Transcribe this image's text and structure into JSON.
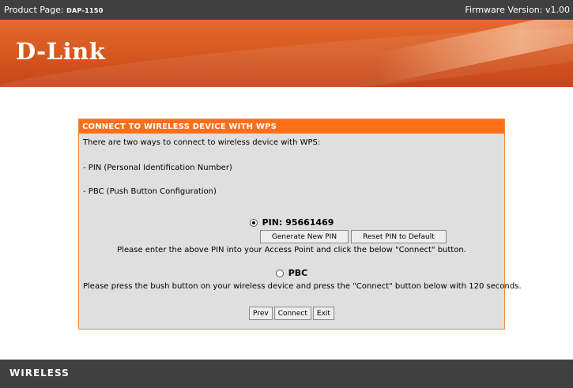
{
  "header": {
    "product_label": "Product Page: ",
    "product_model": "DAP-1150",
    "firmware": "Firmware Version: v1.00"
  },
  "banner": {
    "logo": "D-Link"
  },
  "wps": {
    "title": "CONNECT TO WIRELESS DEVICE WITH WPS",
    "intro": "There are two ways to connect to wireless device with WPS:",
    "option_pin_desc": "- PIN (Personal Identification Number)",
    "option_pbc_desc": "- PBC (Push Button Configuration)",
    "pin_label": "PIN: 95661469",
    "pin_selected": true,
    "generate_button": "Generate New PIN",
    "reset_button": "Reset PIN to Default",
    "pin_instruction": "Please enter the above PIN into your Access Point and click the below \"Connect\" button.",
    "pbc_label": "PBC",
    "pbc_instruction": "Please press the bush button on your wireless device and press the \"Connect\" button below with 120 seconds.",
    "prev_button": "Prev",
    "connect_button": "Connect",
    "exit_button": "Exit"
  },
  "footer": {
    "label": "WIRELESS"
  },
  "colors": {
    "accent": "#ff6f1a",
    "banner": "#d85a20",
    "bar": "#404040",
    "panel_bg": "#dfdfdf"
  }
}
